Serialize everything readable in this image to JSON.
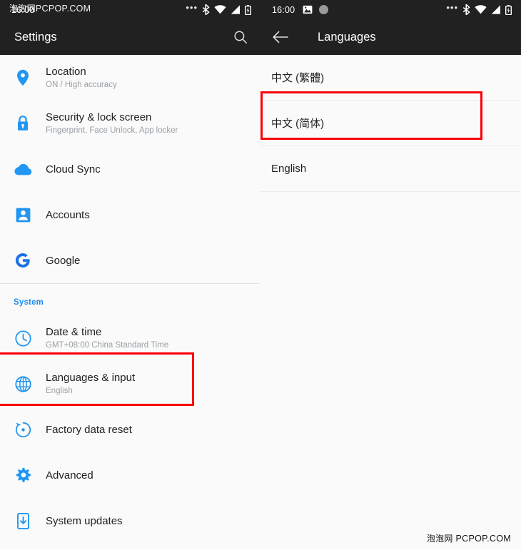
{
  "status_bar": {
    "left": {
      "clock": "16:00",
      "right_icons": [
        "more-dots",
        "bluetooth-icon",
        "wifi-icon",
        "cellular-signal-icon",
        "battery-charging-icon"
      ]
    },
    "right": {
      "clock": "16:00",
      "left_icons": [
        "screenshot-image-icon",
        "gray-circle-icon"
      ],
      "right_icons": [
        "more-dots",
        "bluetooth-icon",
        "wifi-icon",
        "cellular-signal-icon",
        "battery-charging-icon"
      ]
    }
  },
  "left_panel": {
    "appbar": {
      "title": "Settings",
      "action_icon": "search-icon"
    },
    "items": [
      {
        "icon": "location-pin-icon",
        "title": "Location",
        "subtitle": "ON / High accuracy"
      },
      {
        "icon": "lock-icon",
        "title": "Security & lock screen",
        "subtitle": "Fingerprint, Face Unlock, App locker"
      },
      {
        "icon": "cloud-icon",
        "title": "Cloud Sync",
        "subtitle": ""
      },
      {
        "icon": "account-person-icon",
        "title": "Accounts",
        "subtitle": ""
      },
      {
        "icon": "google-g-icon",
        "title": "Google",
        "subtitle": ""
      }
    ],
    "section_header": "System",
    "system_items": [
      {
        "icon": "clock-icon",
        "title": "Date & time",
        "subtitle": "GMT+08:00 China Standard Time"
      },
      {
        "icon": "globe-icon",
        "title": "Languages & input",
        "subtitle": "English"
      },
      {
        "icon": "restore-icon",
        "title": "Factory data reset",
        "subtitle": ""
      },
      {
        "icon": "gear-icon",
        "title": "Advanced",
        "subtitle": ""
      },
      {
        "icon": "system-update-icon",
        "title": "System updates",
        "subtitle": ""
      }
    ]
  },
  "right_panel": {
    "appbar": {
      "back_icon": "back-arrow-icon",
      "title": "Languages"
    },
    "languages": [
      {
        "label": "中文 (繁體)"
      },
      {
        "label": "中文 (简体)"
      },
      {
        "label": "English"
      }
    ]
  },
  "annotations": {
    "color": "#fb0007",
    "boxes": [
      {
        "name": "languages-input-highlight",
        "target": "Languages & input"
      },
      {
        "name": "chinese-simplified-highlight",
        "target": "中文 (简体)"
      }
    ]
  },
  "watermarks": {
    "top": {
      "cn": "泡泡网",
      "en": "PCPOP.COM"
    },
    "bottom": {
      "cn": "泡泡网",
      "en": "PCPOP.COM"
    }
  },
  "colors": {
    "accent_blue": "#1a8cf0",
    "appbar_bg": "#212121",
    "page_bg": "#fafafa",
    "annotation_red": "#fb0007",
    "text_primary": "#202124",
    "text_secondary": "#9aa0a6"
  }
}
